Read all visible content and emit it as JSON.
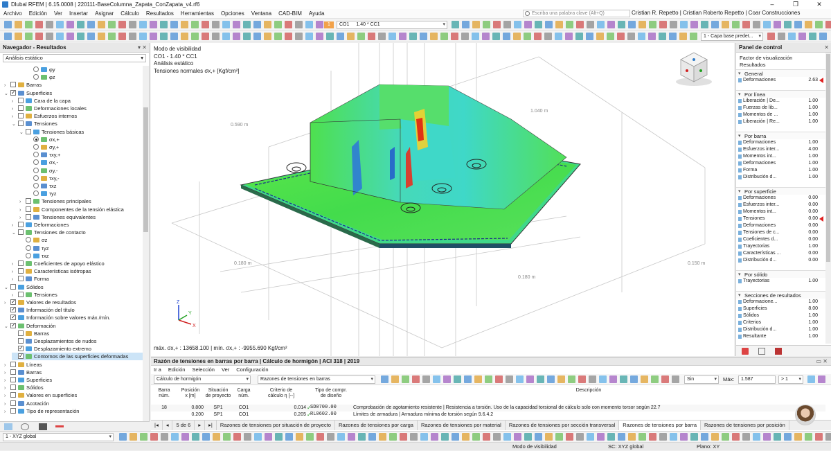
{
  "window": {
    "title": "Dlubal RFEM | 6.15.0008 | 220111-BaseColumna_Zapata_ConZapata_v4.rf6",
    "controls": [
      "–",
      "❐",
      "✕"
    ]
  },
  "menu": [
    "Archivo",
    "Edición",
    "Ver",
    "Insertar",
    "Asignar",
    "Cálculo",
    "Resultados",
    "Herramientas",
    "Opciones",
    "Ventana",
    "CAD-BIM",
    "Ayuda"
  ],
  "search": {
    "placeholder": "Escriba una palabra clave (Alt+Q)"
  },
  "user": "Cristian R. Repetto | Cristian Roberto Repetto | Coar Construcciones",
  "toolbar1": {
    "load_badge": "1",
    "load_case": "CO1",
    "load_combo": "1.40 * CC1",
    "layer_combo": "1 - Capa base predet..."
  },
  "navigator": {
    "title": "Navegador - Resultados",
    "header_icons": "▾ ✕",
    "analysis": "Análisis estático",
    "rows": [
      {
        "depth": 3,
        "kind": "radio",
        "label": "φy"
      },
      {
        "depth": 3,
        "kind": "radio",
        "label": "φz"
      },
      {
        "depth": 0,
        "kind": "check",
        "exp": "›",
        "label": "Barras"
      },
      {
        "depth": 0,
        "kind": "check",
        "on": true,
        "exp": "⌄",
        "label": "Superficies"
      },
      {
        "depth": 1,
        "kind": "check",
        "exp": "›",
        "label": "Cara de la capa"
      },
      {
        "depth": 1,
        "kind": "check",
        "exp": "›",
        "label": "Deformaciones locales"
      },
      {
        "depth": 1,
        "kind": "check",
        "exp": "›",
        "label": "Esfuerzos internos"
      },
      {
        "depth": 1,
        "kind": "check",
        "exp": "⌄",
        "label": "Tensiones"
      },
      {
        "depth": 2,
        "kind": "check",
        "exp": "⌄",
        "label": "Tensiones básicas"
      },
      {
        "depth": 3,
        "kind": "radio",
        "on": true,
        "label": "σx,+"
      },
      {
        "depth": 3,
        "kind": "radio",
        "label": "σy,+"
      },
      {
        "depth": 3,
        "kind": "radio",
        "label": "τxy,+"
      },
      {
        "depth": 3,
        "kind": "radio",
        "label": "σx,-"
      },
      {
        "depth": 3,
        "kind": "radio",
        "label": "σy,-"
      },
      {
        "depth": 3,
        "kind": "radio",
        "label": "τxy,-"
      },
      {
        "depth": 3,
        "kind": "radio",
        "label": "τxz"
      },
      {
        "depth": 3,
        "kind": "radio",
        "label": "τyz"
      },
      {
        "depth": 2,
        "kind": "check",
        "exp": "›",
        "label": "Tensiones principales"
      },
      {
        "depth": 2,
        "kind": "check",
        "exp": "›",
        "label": "Componentes de la tensión elástica"
      },
      {
        "depth": 2,
        "kind": "check",
        "exp": "›",
        "label": "Tensiones equivalentes"
      },
      {
        "depth": 1,
        "kind": "check",
        "exp": "›",
        "label": "Deformaciones"
      },
      {
        "depth": 1,
        "kind": "check",
        "exp": "⌄",
        "label": "Tensiones de contacto"
      },
      {
        "depth": 2,
        "kind": "radio",
        "label": "σz"
      },
      {
        "depth": 2,
        "kind": "radio",
        "label": "τyz"
      },
      {
        "depth": 2,
        "kind": "radio",
        "label": "τxz"
      },
      {
        "depth": 1,
        "kind": "check",
        "exp": "›",
        "label": "Coeficientes de apoyo elástico"
      },
      {
        "depth": 1,
        "kind": "check",
        "exp": "›",
        "label": "Características isótropas"
      },
      {
        "depth": 1,
        "kind": "check",
        "exp": "›",
        "label": "Forma"
      },
      {
        "depth": 0,
        "kind": "check",
        "exp": "⌄",
        "label": "Sólidos"
      },
      {
        "depth": 1,
        "kind": "check",
        "exp": "›",
        "label": "Tensiones"
      },
      {
        "depth": 0,
        "kind": "check",
        "on": true,
        "exp": "›",
        "label": "Valores de resultados"
      },
      {
        "depth": 0,
        "kind": "check",
        "on": true,
        "label": "Información del título"
      },
      {
        "depth": 0,
        "kind": "check",
        "on": true,
        "label": "Información sobre valores máx./mín."
      },
      {
        "depth": 0,
        "kind": "check",
        "on": true,
        "exp": "⌄",
        "label": "Deformación"
      },
      {
        "depth": 1,
        "kind": "check",
        "label": "Barras"
      },
      {
        "depth": 1,
        "kind": "check",
        "label": "Desplazamientos de nudos"
      },
      {
        "depth": 1,
        "kind": "check",
        "on": true,
        "label": "Desplazamiento extremo"
      },
      {
        "depth": 1,
        "kind": "check",
        "on": true,
        "sel": true,
        "label": "Contornos de las superficies deformadas"
      },
      {
        "depth": 0,
        "kind": "check",
        "exp": "›",
        "label": "Líneas"
      },
      {
        "depth": 0,
        "kind": "check",
        "exp": "›",
        "label": "Barras"
      },
      {
        "depth": 0,
        "kind": "check",
        "exp": "›",
        "label": "Superficies"
      },
      {
        "depth": 0,
        "kind": "check",
        "exp": "›",
        "label": "Sólidos"
      },
      {
        "depth": 0,
        "kind": "check",
        "exp": "›",
        "label": "Valores en superficies"
      },
      {
        "depth": 0,
        "kind": "check",
        "exp": "›",
        "label": "Acotación"
      },
      {
        "depth": 0,
        "kind": "check",
        "exp": "›",
        "label": "Tipo de representación"
      }
    ]
  },
  "viewport": {
    "info": [
      "Modo de visibilidad",
      "CO1 - 1.40 * CC1",
      "Análisis estático",
      "Tensiones normales σx,+ [Kgf/cm²]"
    ],
    "minmax": "máx. σx,+ : 13658.100 | mín. σx,+ : -9955.690 Kgf/cm²",
    "dims": [
      "1.040 m",
      "0.590 m",
      "0.180 m",
      "0.180 m",
      "0.150 m"
    ],
    "axes": {
      "x": "X",
      "y": "Y",
      "z": "Z"
    }
  },
  "control_panel": {
    "title": "Panel de control",
    "header_icons": "✕",
    "subtitle1": "Factor de visualización",
    "subtitle2": "Resultados",
    "sections": [
      {
        "title": "General",
        "rows": [
          {
            "label": "Deformaciones",
            "value": "2.63",
            "flag": true
          }
        ]
      },
      {
        "title": "Por línea",
        "rows": [
          {
            "label": "Liberación | De...",
            "value": "1.00"
          },
          {
            "label": "Fuerzas de lib...",
            "value": "1.00"
          },
          {
            "label": "Momentos de ...",
            "value": "1.00"
          },
          {
            "label": "Liberación | Re...",
            "value": "1.00"
          }
        ]
      },
      {
        "title": "Por barra",
        "rows": [
          {
            "label": "Deformaciones",
            "value": "1.00"
          },
          {
            "label": "Esfuerzos inter...",
            "value": "4.00"
          },
          {
            "label": "Momentos int...",
            "value": "1.00"
          },
          {
            "label": "Deformaciones",
            "value": "1.00"
          },
          {
            "label": "Forma",
            "value": "1.00"
          },
          {
            "label": "Distribución d...",
            "value": "1.00"
          }
        ]
      },
      {
        "title": "Por superficie",
        "rows": [
          {
            "label": "Deformaciones",
            "value": "0.00"
          },
          {
            "label": "Esfuerzos inter...",
            "value": "0.00"
          },
          {
            "label": "Momentos int...",
            "value": "0.00"
          },
          {
            "label": "Tensiones",
            "value": "0.00",
            "flag": true
          },
          {
            "label": "Deformaciones",
            "value": "0.00"
          },
          {
            "label": "Tensiones de c...",
            "value": "0.00"
          },
          {
            "label": "Coeficientes d...",
            "value": "0.00"
          },
          {
            "label": "Trayectorias",
            "value": "1.00"
          },
          {
            "label": "Características ...",
            "value": "0.00"
          },
          {
            "label": "Distribución d...",
            "value": "0.00"
          }
        ]
      },
      {
        "title": "Por sólido",
        "rows": [
          {
            "label": "Trayectorias",
            "value": "1.00"
          }
        ]
      },
      {
        "title": "Secciones de resultados",
        "rows": [
          {
            "label": "Deformacione...",
            "value": "1.00"
          },
          {
            "label": "Superficies",
            "value": "8.00"
          },
          {
            "label": "Sólidos",
            "value": "1.00"
          },
          {
            "label": "Criterios",
            "value": "1.00"
          },
          {
            "label": "Distribución d...",
            "value": "1.00"
          },
          {
            "label": "Resultante",
            "value": "1.00"
          }
        ]
      }
    ]
  },
  "results": {
    "title": "Razón de tensiones en barras por barra | Cálculo de hormigón | ACI 318 | 2019",
    "menu": [
      "Ir a",
      "Edición",
      "Selección",
      "Ver",
      "Configuración"
    ],
    "module_combo": "Cálculo de hormigón",
    "table_combo": "Razones de tensiones en barras",
    "filter_combo": "Sin",
    "max_label": "Máx:",
    "max_value": "1.587",
    "gt_label": "> 1",
    "columns": [
      {
        "l1": "Barra",
        "l2": "núm."
      },
      {
        "l1": "Posición",
        "l2": "x [m]"
      },
      {
        "l1": "Situación",
        "l2": "de proyecto"
      },
      {
        "l1": "Carga",
        "l2": "núm."
      },
      {
        "l1": "Criterio de",
        "l2": "cálculo η [--]"
      },
      {
        "l1": "Tipo de compr.",
        "l2": "de diseño"
      },
      {
        "l1": "",
        "l2": "Descripción"
      }
    ],
    "rows": [
      {
        "bar": "18",
        "pos": "0.800",
        "sit": "SP1",
        "load": "CO1",
        "eta": "0.014",
        "type": "SD0700.00",
        "desc": "Comprobación de agotamiento resistente | Resistencia a torsión. Uso de la capacidad torsional de cálculo solo con momento torsor según 22.7"
      },
      {
        "bar": "",
        "pos": "0.200",
        "sit": "SP1",
        "load": "CO1",
        "eta": "0.205",
        "type": "RL0602.00",
        "desc": "Límites de armadura | Armadura mínima de torsión según 9.6.4.2"
      }
    ]
  },
  "tabs": {
    "pager": "5 de 6",
    "items": [
      "Razones de tensiones por situación de proyecto",
      "Razones de tensiones por carga",
      "Razones de tensiones por material",
      "Razones de tensiones por sección transversal",
      "Razones de tensiones por barra",
      "Razones de tensiones por posición"
    ],
    "active_index": 4
  },
  "bottom_toolbar": {
    "view_combo": "1 - XYZ global"
  },
  "status": {
    "visibility": "Modo de visibilidad",
    "cs": "SC: XYZ global",
    "plane": "Plano: XY"
  },
  "colors": {
    "accent": "#2e7bc9",
    "selection": "#cce4f7",
    "flag": "#e02020",
    "fe_green": "#4fe04a",
    "fe_cyan": "#3fd8c8"
  }
}
